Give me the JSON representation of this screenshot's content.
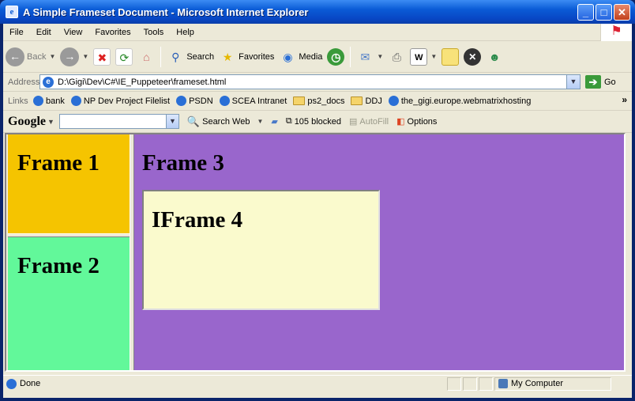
{
  "window": {
    "title": "A Simple Frameset Document - Microsoft Internet Explorer",
    "minimize": "_",
    "maximize": "□",
    "close": "✕"
  },
  "menu": [
    "File",
    "Edit",
    "View",
    "Favorites",
    "Tools",
    "Help"
  ],
  "toolbar": {
    "back": "Back",
    "search": "Search",
    "favorites": "Favorites",
    "media": "Media"
  },
  "address": {
    "label": "Address",
    "value": "D:\\Gigi\\Dev\\C#\\IE_Puppeteer\\frameset.html",
    "go": "Go"
  },
  "links": {
    "label": "Links",
    "items": [
      "bank",
      "NP Dev Project Filelist",
      "PSDN",
      "SCEA Intranet",
      "ps2_docs",
      "DDJ",
      "the_gigi.europe.webmatrixhosting"
    ],
    "more": "»"
  },
  "google": {
    "logo": "Google",
    "search_web": "Search Web",
    "blocked": "105 blocked",
    "autofill": "AutoFill",
    "options": "Options"
  },
  "frames": {
    "frame1": "Frame 1",
    "frame2": "Frame 2",
    "frame3": "Frame 3",
    "iframe4": "IFrame 4"
  },
  "colors": {
    "frame1": "#f5c400",
    "frame2": "#62f89a",
    "frame3": "#9966cc",
    "iframe4": "#fafacd"
  },
  "status": {
    "text": "Done",
    "zone": "My Computer"
  }
}
